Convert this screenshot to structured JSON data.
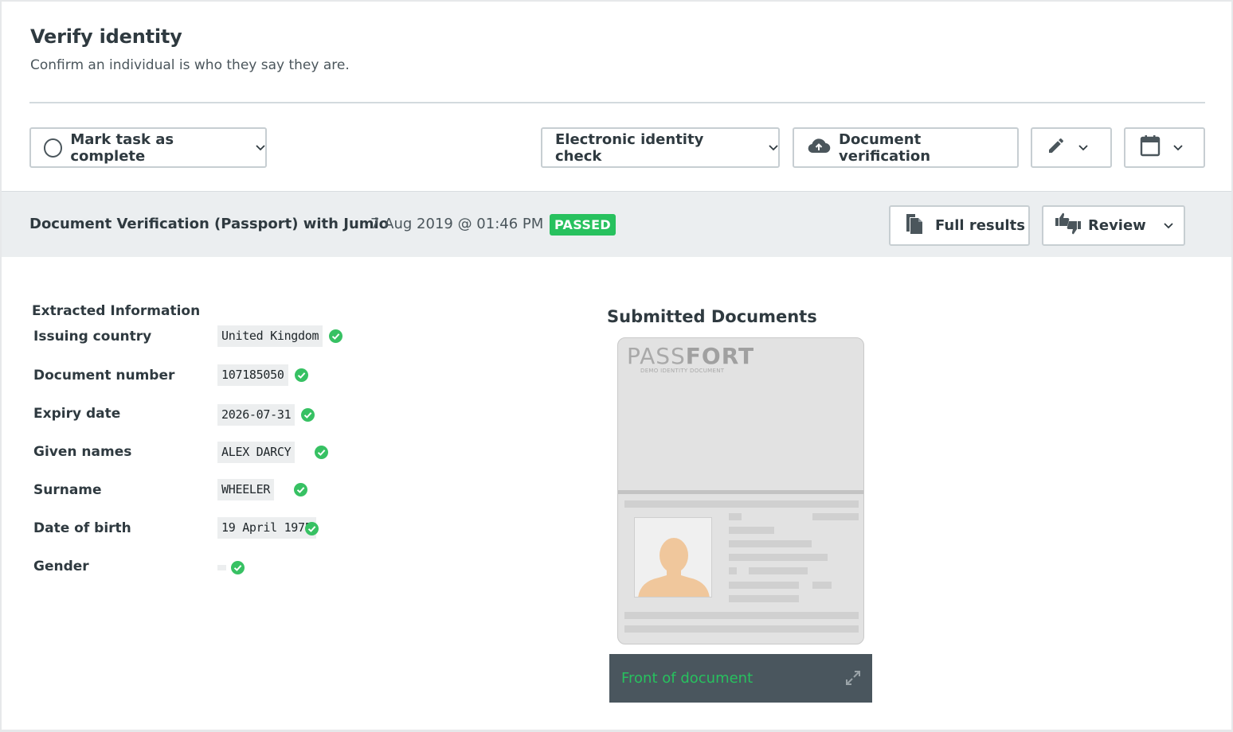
{
  "header": {
    "title": "Verify identity",
    "subtitle": "Confirm an individual is who they say they are."
  },
  "toolbar": {
    "mark_complete": "Mark task as complete",
    "electronic_check": "Electronic identity check",
    "document_verification": "Document verification"
  },
  "result": {
    "title": "Document Verification (Passport) with Jumio",
    "date": "7 Aug 2019 @ 01:46 PM",
    "status": "PASSED",
    "full_results": "Full results",
    "review": "Review"
  },
  "extracted": {
    "heading": "Extracted Information",
    "rows": [
      {
        "label": "Issuing country",
        "value": "United Kingdom"
      },
      {
        "label": "Document number",
        "value": "107185050"
      },
      {
        "label": "Expiry date",
        "value": "2026-07-31"
      },
      {
        "label": "Given names",
        "value": "ALEX DARCY"
      },
      {
        "label": "Surname",
        "value": "WHEELER"
      },
      {
        "label": "Date of birth",
        "value": "19 April 1975"
      },
      {
        "label": "Gender",
        "value": ""
      }
    ]
  },
  "documents": {
    "heading": "Submitted Documents",
    "logo_light": "PASS",
    "logo_bold": "FORT",
    "logo_caption": "DEMO IDENTITY DOCUMENT",
    "caption": "Front of document"
  },
  "colors": {
    "accent_green": "#27c15e",
    "check_green": "#37c163",
    "caption_bar": "#4a565e"
  }
}
